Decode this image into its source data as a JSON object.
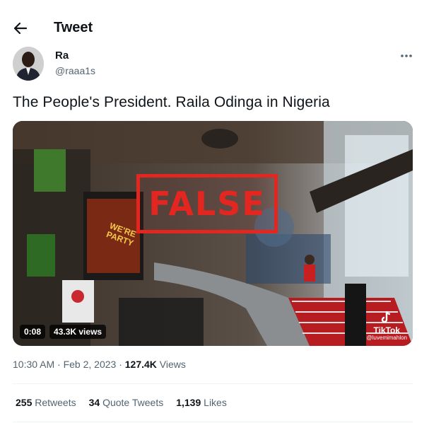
{
  "header": {
    "title": "Tweet"
  },
  "author": {
    "name": "Ra",
    "handle": "@raaa1s"
  },
  "tweet": {
    "text": "The People's President. Raila Odinga in Nigeria"
  },
  "media": {
    "stamp": "FALSE",
    "duration": "0:08",
    "views": "43.3K views",
    "watermark_brand": "TikTok",
    "watermark_user": "@luvemimahlon",
    "sign_text": "WE'RE PARTY"
  },
  "meta": {
    "timestamp": "10:30 AM · Feb 2, 2023 · ",
    "views_count": "127.4K",
    "views_label": " Views"
  },
  "stats": {
    "retweets_count": "255",
    "retweets_label": "Retweets",
    "quotes_count": "34",
    "quotes_label": "Quote Tweets",
    "likes_count": "1,139",
    "likes_label": "Likes"
  }
}
